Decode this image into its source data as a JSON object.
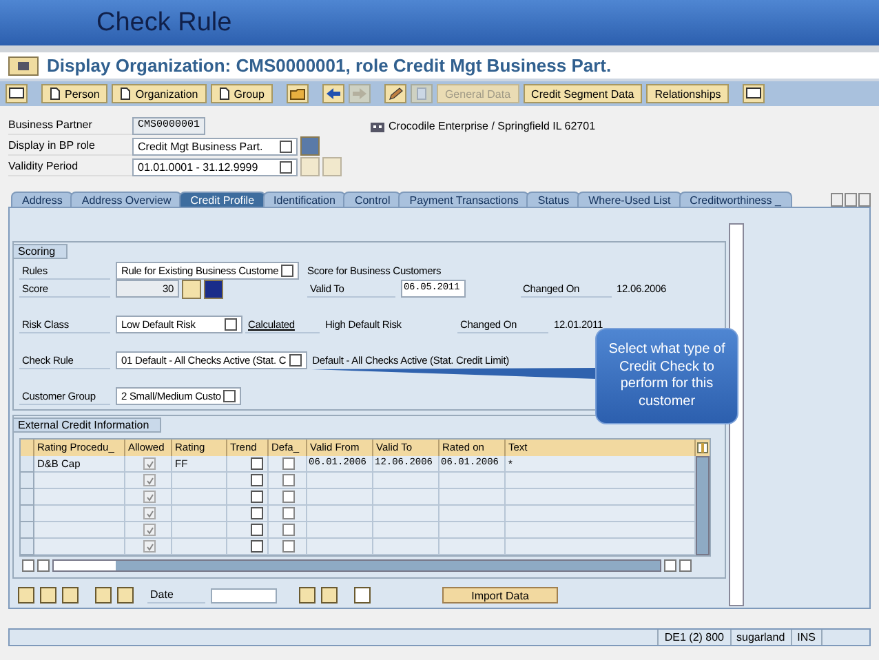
{
  "slide_title": "Check Rule",
  "window": {
    "title": "Display Organization: CMS0000001, role Credit Mgt Business Part."
  },
  "toolbar": [
    {
      "kind": "monitor",
      "disabled": false
    },
    {
      "kind": "button",
      "label": "Person",
      "doc": true,
      "disabled": false
    },
    {
      "kind": "button",
      "label": "Organization",
      "doc": true,
      "disabled": false
    },
    {
      "kind": "button",
      "label": "Group",
      "doc": true,
      "disabled": false
    },
    {
      "kind": "folder",
      "disabled": false
    },
    {
      "kind": "back",
      "disabled": false
    },
    {
      "kind": "forward",
      "disabled": true
    },
    {
      "kind": "pencil",
      "disabled": false
    },
    {
      "kind": "copy",
      "disabled": true
    },
    {
      "kind": "button",
      "label": "General Data",
      "doc": false,
      "disabled": true
    },
    {
      "kind": "button",
      "label": "Credit Segment Data",
      "doc": false,
      "disabled": false
    },
    {
      "kind": "button",
      "label": "Relationships",
      "doc": false,
      "disabled": false
    },
    {
      "kind": "monitor",
      "disabled": false
    }
  ],
  "header": {
    "business_partner": {
      "label": "Business Partner",
      "value": "CMS0000001",
      "description": "Crocodile Enterprise / Springfield IL 62701"
    },
    "bp_role": {
      "label": "Display in BP role",
      "value": "Credit Mgt Business Part."
    },
    "validity": {
      "label": "Validity Period",
      "value": "01.01.0001 - 31.12.9999"
    }
  },
  "tabs": [
    {
      "label": "Address",
      "selected": false
    },
    {
      "label": "Address Overview",
      "selected": false
    },
    {
      "label": "Credit Profile",
      "selected": true
    },
    {
      "label": "Identification",
      "selected": false
    },
    {
      "label": "Control",
      "selected": false
    },
    {
      "label": "Payment Transactions",
      "selected": false
    },
    {
      "label": "Status",
      "selected": false
    },
    {
      "label": "Where-Used List",
      "selected": false
    },
    {
      "label": "Creditworthiness _",
      "selected": false
    }
  ],
  "scoring": {
    "title": "Scoring",
    "rules": {
      "label": "Rules",
      "value": "Rule for Existing Business Custome",
      "description": "Score for Business Customers"
    },
    "score": {
      "label": "Score",
      "value": "30",
      "valid_to_label": "Valid To",
      "valid_to": "06.05.2011",
      "changed_label": "Changed On",
      "changed": "12.06.2006"
    },
    "risk_class": {
      "label": "Risk Class",
      "value": "Low Default Risk",
      "link": "Calculated",
      "description": "High Default Risk",
      "changed_label": "Changed On",
      "changed": "12.01.2011"
    },
    "check_rule": {
      "label": "Check Rule",
      "value": "01 Default - All Checks Active (Stat. C",
      "description": "Default - All Checks Active (Stat. Credit Limit)"
    },
    "customer_group": {
      "label": "Customer Group",
      "value": "2 Small/Medium Custo"
    }
  },
  "callout": "Select what type of Credit Check to perform for this customer",
  "external_credit": {
    "title": "External Credit Information",
    "columns": [
      "Rating Procedu_",
      "Allowed",
      "Rating",
      "Trend",
      "Defa_",
      "Valid From",
      "Valid To",
      "Rated on",
      "Text"
    ],
    "rows": [
      {
        "procedure": "D&B Cap",
        "allowed": true,
        "rating": "FF",
        "default": false,
        "valid_from": "06.01.2006",
        "valid_to": "12.06.2006",
        "rated_on": "06.01.2006",
        "text": "*"
      },
      {
        "allowed": true,
        "default": false
      },
      {
        "allowed": true,
        "default": false
      },
      {
        "allowed": true,
        "default": false
      },
      {
        "allowed": true,
        "default": false
      },
      {
        "allowed": true,
        "default": false
      }
    ]
  },
  "bottom": {
    "date_label": "Date",
    "import_button": "Import Data"
  },
  "status_bar": {
    "system": "DE1 (2) 800",
    "server": "sugarland",
    "mode": "INS"
  }
}
